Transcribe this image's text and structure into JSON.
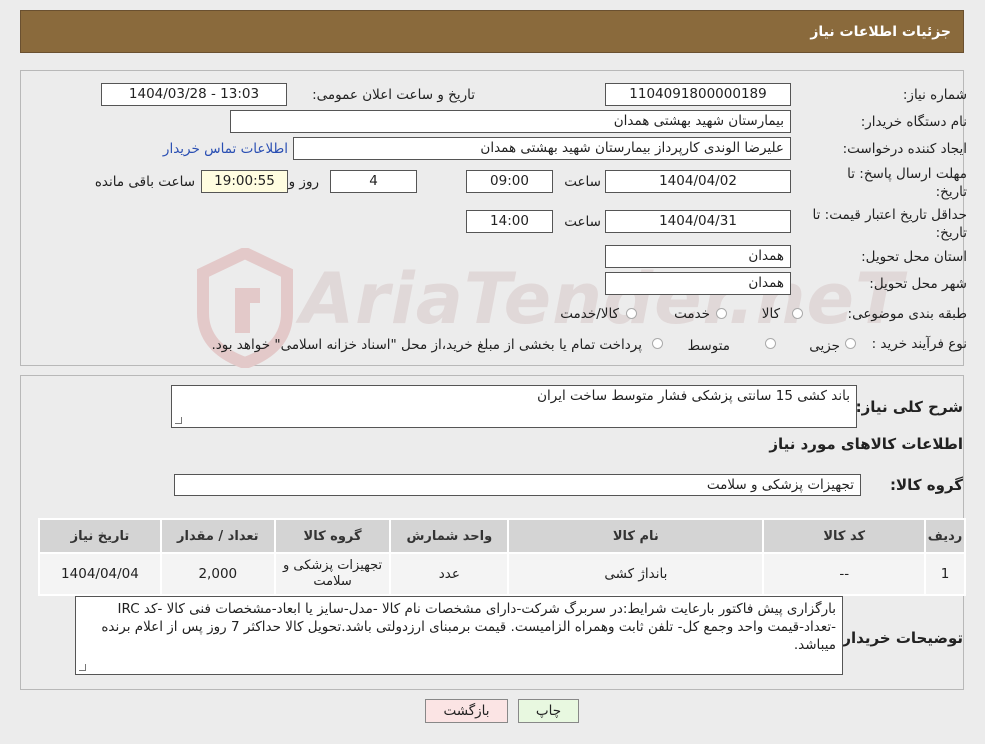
{
  "header": {
    "title": "جزئیات اطلاعات نیاز"
  },
  "form": {
    "need_number_label": "شماره نیاز:",
    "need_number": "1104091800000189",
    "announce_label": "تاریخ و ساعت اعلان عمومی:",
    "announce_value": "1404/03/28 - 13:03",
    "buyer_org_label": "نام دستگاه خریدار:",
    "buyer_org": "بیمارستان شهید بهشتی همدان",
    "requester_label": "ایجاد کننده درخواست:",
    "requester": "علیرضا الوندی کارپرداز بیمارستان شهید بهشتی همدان",
    "contact_link": "اطلاعات تماس خریدار",
    "deadline_label_1": "مهلت ارسال پاسخ: تا",
    "deadline_label_2": "تاریخ:",
    "deadline_date": "1404/04/02",
    "time_label": "ساعت",
    "deadline_time": "09:00",
    "days_value": "4",
    "days_label": "روز و",
    "remaining_time": "19:00:55",
    "remaining_label": "ساعت باقی مانده",
    "validity_label_1": "حداقل تاریخ اعتبار قیمت: تا",
    "validity_label_2": "تاریخ:",
    "validity_date": "1404/04/31",
    "validity_time_label": "ساعت",
    "validity_time": "14:00",
    "province_label": "استان محل تحویل:",
    "province": "همدان",
    "city_label": "شهر محل تحویل:",
    "city": "همدان",
    "category_label": "طبقه بندی موضوعی:",
    "category_options": [
      "کالا",
      "خدمت",
      "کالا/خدمت"
    ],
    "process_label": "نوع فرآیند خرید :",
    "process_options": [
      "جزیی",
      "متوسط"
    ],
    "process_note": "پرداخت تمام یا بخشی از مبلغ خرید،از محل \"اسناد خزانه اسلامی\" خواهد بود."
  },
  "details": {
    "summary_label": "شرح کلی نیاز:",
    "summary": "باند کشی 15 سانتی پزشکی فشار متوسط  ساخت ایران",
    "goods_info_title": "اطلاعات کالاهای مورد نیاز",
    "group_label": "گروه کالا:",
    "group_value": "تجهیزات پزشکی و سلامت",
    "table": {
      "headers": [
        "ردیف",
        "کد کالا",
        "نام کالا",
        "واحد شمارش",
        "گروه کالا",
        "تعداد / مقدار",
        "تاریخ نیاز"
      ],
      "rows": [
        [
          "1",
          "--",
          "بانداژ کشی",
          "عدد",
          "تجهیزات پزشکی و سلامت",
          "2,000",
          "1404/04/04"
        ]
      ]
    },
    "notes_label": "توضیحات خریدار:",
    "notes": "بارگزاری پیش فاکتور بارعایت شرایط:در سربرگ شرکت-دارای مشخصات نام کالا -مدل-سایز یا ابعاد-مشخصات فنی کالا -کد IRC -تعداد-قیمت واحد وجمع کل- تلفن ثابت وهمراه الزامیست. قیمت برمبنای ارزدولتی باشد.تحویل کالا حداکثر 7 روز پس از اعلام برنده میباشد."
  },
  "buttons": {
    "print": "چاپ",
    "back": "بازگشت"
  },
  "watermark": {
    "text": "AriaTender.neT"
  },
  "colors": {
    "header_bg": "#8a6a3c",
    "print_btn": "#e8f8e0",
    "back_btn": "#fbe4e4"
  }
}
